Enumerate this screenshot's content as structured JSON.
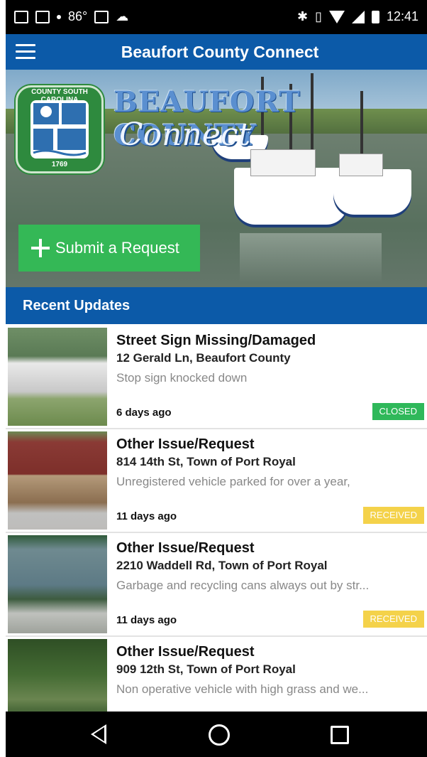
{
  "status_bar": {
    "temperature": "86°",
    "time": "12:41"
  },
  "app_bar": {
    "title": "Beaufort County Connect"
  },
  "hero": {
    "seal_top_text": "COUNTY SOUTH CAROLINA",
    "seal_left_text": "BEAUFORT",
    "seal_year": "1769",
    "title_line1": "BEAUFORT COUNTY",
    "title_line2": "Connect",
    "submit_label": "Submit a Request"
  },
  "section": {
    "title": "Recent Updates"
  },
  "updates": [
    {
      "title": "Street Sign Missing/Damaged",
      "address": "12 Gerald Ln, Beaufort County",
      "description": "Stop sign knocked down",
      "time": "6 days ago",
      "status": "CLOSED"
    },
    {
      "title": "Other Issue/Request",
      "address": "814 14th St, Town of Port Royal",
      "description": "Unregistered vehicle parked for over a year,",
      "time": "11 days ago",
      "status": "RECEIVED"
    },
    {
      "title": "Other Issue/Request",
      "address": "2210 Waddell Rd, Town of Port Royal",
      "description": "Garbage and recycling cans always out by str...",
      "time": "11 days ago",
      "status": "RECEIVED"
    },
    {
      "title": "Other Issue/Request",
      "address": "909 12th St, Town of Port Royal",
      "description": "Non operative vehicle with high grass and we...",
      "time": "",
      "status": ""
    }
  ],
  "colors": {
    "primary": "#0c5aa8",
    "accent_green": "#34b856",
    "closed": "#2fb85a",
    "received": "#f4d24a"
  }
}
